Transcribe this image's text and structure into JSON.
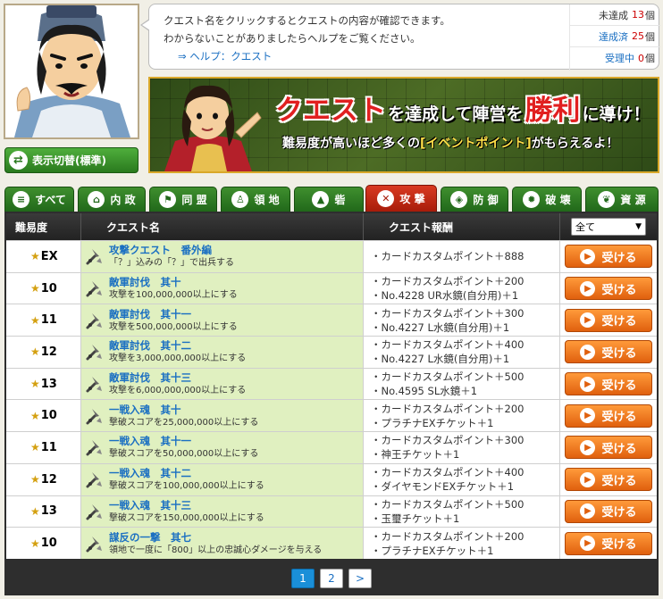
{
  "header": {
    "message_line1": "クエスト名をクリックするとクエストの内容が確認できます。",
    "message_line2": "わからないことがありましたらヘルプをご覧ください。",
    "help_arrow": "⇒",
    "help_link": "ヘルプ：クエスト",
    "stats": [
      {
        "label": "未達成",
        "count": "13",
        "unit": "個"
      },
      {
        "label": "達成済",
        "count": "25",
        "unit": "個"
      },
      {
        "label": "受理中",
        "count": "0",
        "unit": "個"
      }
    ],
    "display_toggle_label": "表示切替(標準)"
  },
  "banner": {
    "title_part1": "クエスト",
    "title_part2": "を達成して陣営を",
    "title_part3": "勝利",
    "title_part4": "に導け！",
    "subtitle_pre": "難易度が高いほど多くの",
    "subtitle_highlight": "[イベントポイント]",
    "subtitle_post": "がもらえるよ！"
  },
  "tabs": [
    {
      "label": "すべて",
      "icon": "list-icon",
      "glyph": "≡"
    },
    {
      "label": "内 政",
      "icon": "house-icon",
      "glyph": "⌂"
    },
    {
      "label": "同 盟",
      "icon": "flag-icon",
      "glyph": "⚑"
    },
    {
      "label": "領 地",
      "icon": "person-icon",
      "glyph": "♙"
    },
    {
      "label": "砦",
      "icon": "fort-icon",
      "glyph": "▲"
    },
    {
      "label": "攻 撃",
      "icon": "swords-icon",
      "glyph": "✕"
    },
    {
      "label": "防 御",
      "icon": "shield-icon",
      "glyph": "◈"
    },
    {
      "label": "破 壊",
      "icon": "fire-icon",
      "glyph": "✹"
    },
    {
      "label": "資 源",
      "icon": "leaf-icon",
      "glyph": "❦"
    }
  ],
  "active_tab": 5,
  "table": {
    "headers": {
      "difficulty": "難易度",
      "name": "クエスト名",
      "reward": "クエスト報酬"
    },
    "filter": {
      "selected": "全て",
      "arrow": "▼"
    },
    "accept_label": "受ける",
    "star": "★",
    "rows": [
      {
        "difficulty": "EX",
        "name": "攻撃クエスト　番外編",
        "desc": "「？」込みの「？」で出兵する",
        "rewards": [
          "・カードカスタムポイント＋888"
        ]
      },
      {
        "difficulty": "10",
        "name": "敵軍討伐　其十",
        "desc": "攻撃を100,000,000以上にする",
        "rewards": [
          "・カードカスタムポイント＋200",
          "・No.4228 UR水鏡(自分用)＋1"
        ]
      },
      {
        "difficulty": "11",
        "name": "敵軍討伐　其十一",
        "desc": "攻撃を500,000,000以上にする",
        "rewards": [
          "・カードカスタムポイント＋300",
          "・No.4227 L水鏡(自分用)＋1"
        ]
      },
      {
        "difficulty": "12",
        "name": "敵軍討伐　其十二",
        "desc": "攻撃を3,000,000,000以上にする",
        "rewards": [
          "・カードカスタムポイント＋400",
          "・No.4227 L水鏡(自分用)＋1"
        ]
      },
      {
        "difficulty": "13",
        "name": "敵軍討伐　其十三",
        "desc": "攻撃を6,000,000,000以上にする",
        "rewards": [
          "・カードカスタムポイント＋500",
          "・No.4595 SL水鏡＋1"
        ]
      },
      {
        "difficulty": "10",
        "name": "一戦入魂　其十",
        "desc": "撃破スコアを25,000,000以上にする",
        "rewards": [
          "・カードカスタムポイント＋200",
          "・プラチナEXチケット＋1"
        ]
      },
      {
        "difficulty": "11",
        "name": "一戦入魂　其十一",
        "desc": "撃破スコアを50,000,000以上にする",
        "rewards": [
          "・カードカスタムポイント＋300",
          "・神王チケット＋1"
        ]
      },
      {
        "difficulty": "12",
        "name": "一戦入魂　其十二",
        "desc": "撃破スコアを100,000,000以上にする",
        "rewards": [
          "・カードカスタムポイント＋400",
          "・ダイヤモンドEXチケット＋1"
        ]
      },
      {
        "difficulty": "13",
        "name": "一戦入魂　其十三",
        "desc": "撃破スコアを150,000,000以上にする",
        "rewards": [
          "・カードカスタムポイント＋500",
          "・玉璽チケット＋1"
        ]
      },
      {
        "difficulty": "10",
        "name": "謀反の一撃　其七",
        "desc": "領地で一度に「800」以上の忠誠心ダメージを与える",
        "rewards": [
          "・カードカスタムポイント＋200",
          "・プラチナEXチケット＋1"
        ]
      }
    ]
  },
  "pagination": {
    "pages": [
      "1",
      "2"
    ],
    "current": "1",
    "next": ">"
  }
}
